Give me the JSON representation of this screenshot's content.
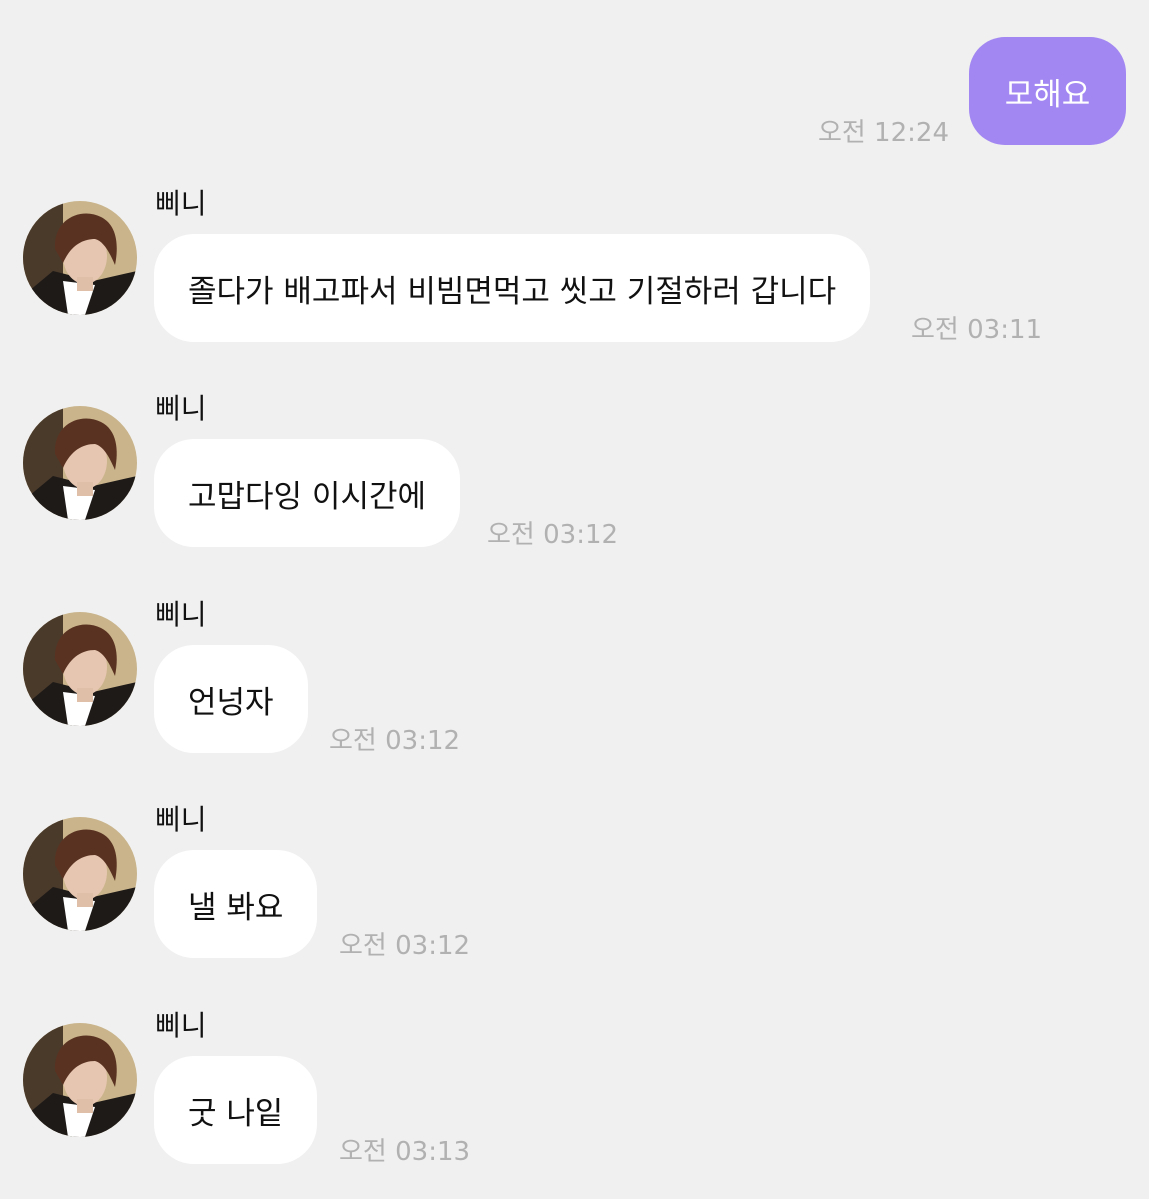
{
  "sent": {
    "text": "모해요",
    "time": "오전 12:24"
  },
  "colors": {
    "background": "#f0f0f0",
    "sent_bubble": "#a287f2",
    "received_bubble": "#ffffff",
    "timestamp": "#b1b1b1"
  },
  "messages": [
    {
      "sender": "삐니",
      "text": "졸다가 배고파서 비빔면먹고 씻고 기절하러 갑니다",
      "time": "오전 03:11"
    },
    {
      "sender": "삐니",
      "text": "고맙다잉 이시간에",
      "time": "오전 03:12"
    },
    {
      "sender": "삐니",
      "text": "언넝자",
      "time": "오전 03:12"
    },
    {
      "sender": "삐니",
      "text": "낼 봐요",
      "time": "오전 03:12"
    },
    {
      "sender": "삐니",
      "text": "굿 나잍",
      "time": "오전 03:13"
    }
  ]
}
